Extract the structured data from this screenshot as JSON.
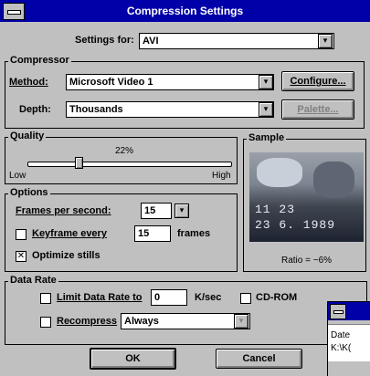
{
  "window": {
    "title": "Compression Settings"
  },
  "settings_for": {
    "label": "Settings for:",
    "value": "AVI"
  },
  "compressor": {
    "group_label": "Compressor",
    "method_label": "Method:",
    "method_value": "Microsoft Video 1",
    "configure_label": "Configure...",
    "depth_label": "Depth:",
    "depth_value": "Thousands",
    "palette_label": "Palette..."
  },
  "quality": {
    "group_label": "Quality",
    "percent_text": "22%",
    "value": 22,
    "low_label": "Low",
    "high_label": "High"
  },
  "sample": {
    "group_label": "Sample",
    "overlay_line1": "11  23",
    "overlay_line2": "23  6. 1989",
    "ratio_text": "Ratio = ~6%"
  },
  "options": {
    "group_label": "Options",
    "fps_label": "Frames per second:",
    "fps_value": "15",
    "keyframe_label": "Keyframe every",
    "keyframe_value": "15",
    "keyframe_unit": "frames",
    "keyframe_checked": false,
    "optimize_label": "Optimize stills",
    "optimize_checked": true
  },
  "data_rate": {
    "group_label": "Data Rate",
    "limit_label": "Limit Data Rate to",
    "limit_value": "0",
    "limit_unit": "K/sec",
    "cdrom_label": "CD-ROM",
    "recompress_label": "Recompress",
    "recompress_value": "Always"
  },
  "buttons": {
    "ok": "OK",
    "cancel": "Cancel"
  },
  "background_window": {
    "line1": "Date",
    "line2": "K:\\K("
  },
  "icons": {
    "dropdown": "▾",
    "check": "✕"
  },
  "colors": {
    "titlebar": "#0000a8",
    "face": "#c0c0c0"
  }
}
